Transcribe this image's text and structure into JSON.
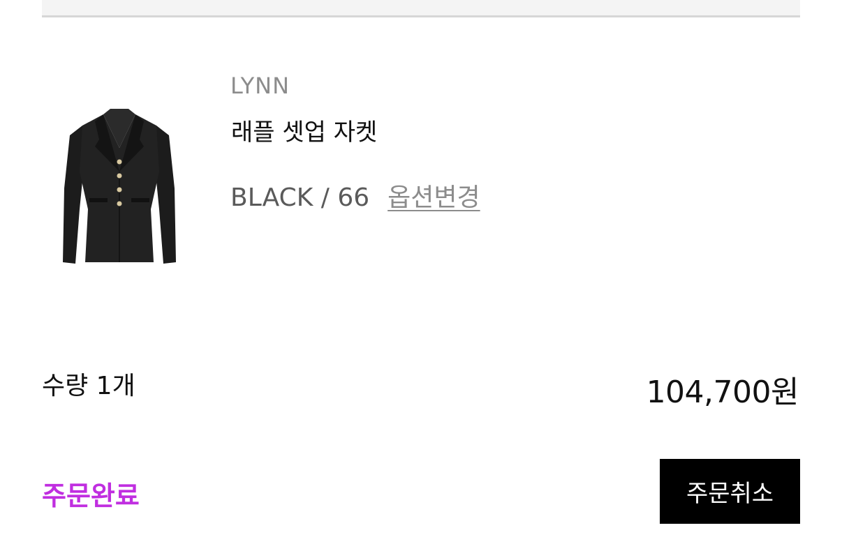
{
  "product": {
    "brand": "LYNN",
    "name": "래플 셋업 자켓",
    "option": "BLACK / 66",
    "change_option_label": "옵션변경",
    "image_icon": "black-tweed-jacket-image"
  },
  "order": {
    "quantity_text": "수량 1개",
    "price_text": "104,700원",
    "status_text": "주문완료",
    "status_color": "#c02ee0",
    "cancel_label": "주문취소"
  }
}
